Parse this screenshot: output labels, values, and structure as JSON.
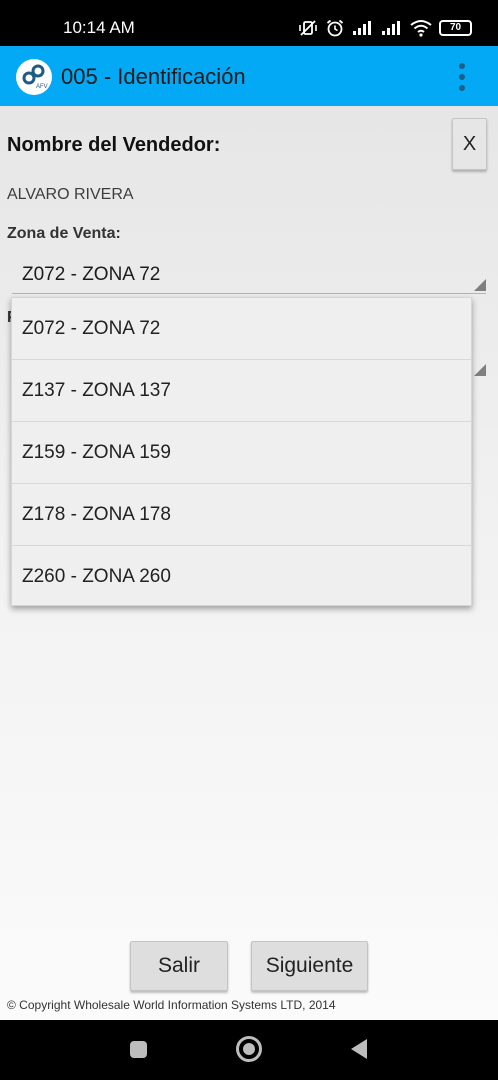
{
  "status_bar": {
    "time": "10:14 AM",
    "battery": "70"
  },
  "app_bar": {
    "title": "005 - Identificación",
    "logo_text": "AFV",
    "overflow_icon": "more-vert-icon"
  },
  "form": {
    "vendor_label": "Nombre del Vendedor:",
    "close_label": "X",
    "vendor_name": "ALVARO RIVERA",
    "zone_label": "Zona de Venta:",
    "zone_selected": "Z072 - ZONA 72",
    "hidden_label_initial": "P"
  },
  "dropdown": {
    "options": [
      "Z072 - ZONA 72",
      "Z137 - ZONA 137",
      "Z159 - ZONA 159",
      "Z178 - ZONA 178",
      "Z260 - ZONA 260"
    ]
  },
  "buttons": {
    "exit_label": "Salir",
    "next_label": "Siguiente"
  },
  "footer": {
    "copyright": "© Copyright Wholesale World Information Systems LTD, 2014"
  },
  "colors": {
    "app_bar": "#03a9f4",
    "overflow_dots": "#1c5f88",
    "status_bar": "#000000"
  }
}
